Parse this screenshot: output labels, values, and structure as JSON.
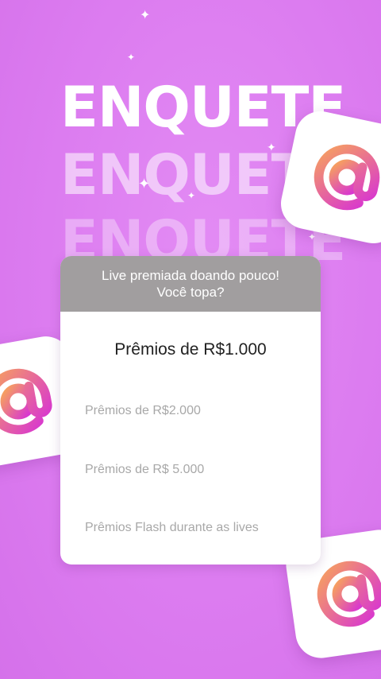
{
  "headline": {
    "word": "ENQUETE"
  },
  "poll": {
    "question_line1": "Live premiada doando pouco!",
    "question_line2": "Você topa?",
    "options": [
      {
        "label": "Prêmios de R$1.000"
      },
      {
        "label": "Prêmios de R$2.000"
      },
      {
        "label": "Prêmios de R$ 5.000"
      },
      {
        "label": "Prêmios Flash durante as lives"
      }
    ]
  },
  "icons": {
    "tile": "at-sign-icon",
    "sparkle": "sparkle-icon"
  },
  "colors": {
    "background": "#dc7cf0",
    "header": "#a19e9f",
    "at_gradient_start": "#f7a35c",
    "at_gradient_end": "#d62fd8"
  }
}
